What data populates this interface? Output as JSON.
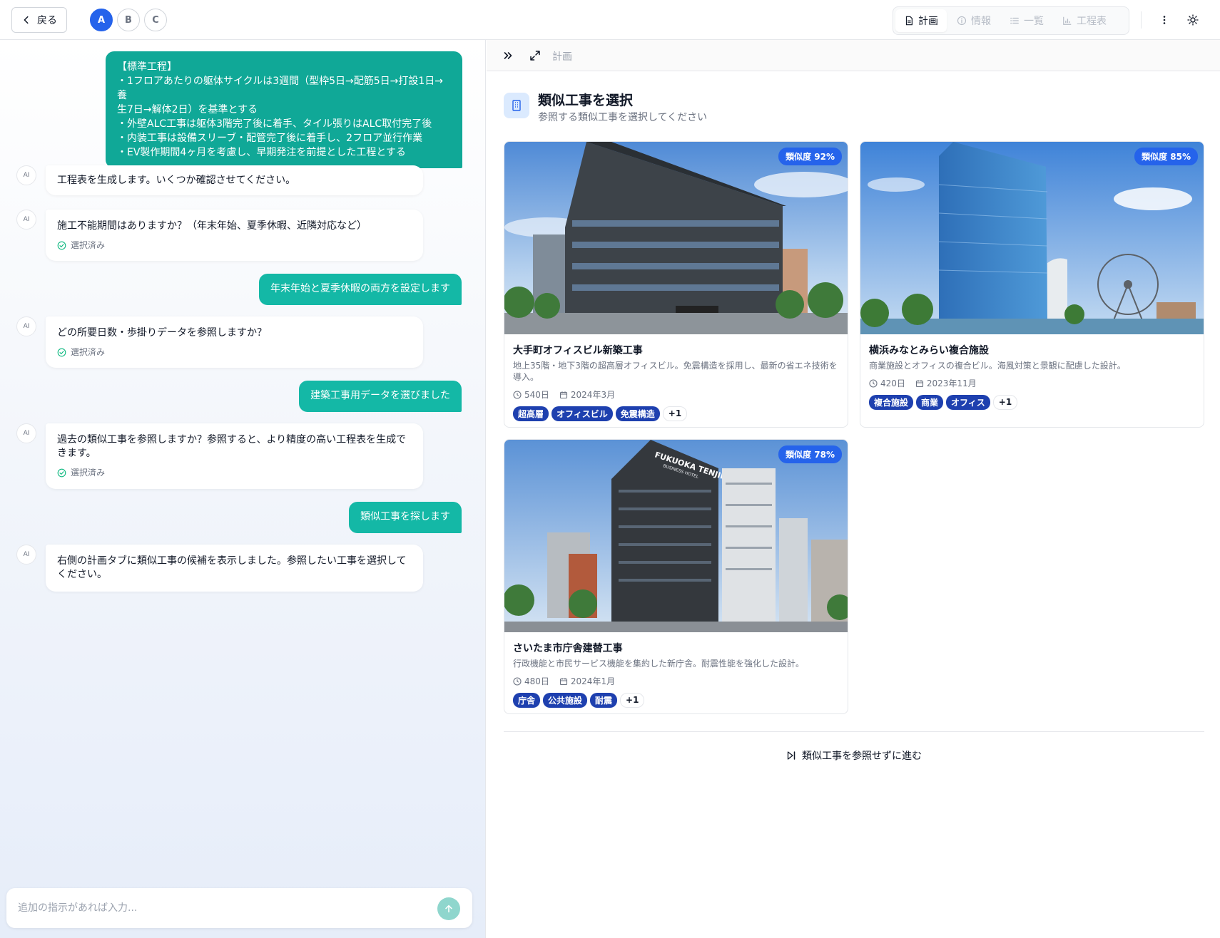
{
  "header": {
    "back_label": "戻る",
    "versions": [
      "A",
      "B",
      "C"
    ],
    "tabs": [
      {
        "label": "計画",
        "icon": "document-icon",
        "active": true
      },
      {
        "label": "情報",
        "icon": "info-icon",
        "active": false
      },
      {
        "label": "一覧",
        "icon": "list-icon",
        "active": false
      },
      {
        "label": "工程表",
        "icon": "bar-chart-icon",
        "active": false
      }
    ]
  },
  "chat": {
    "ai_badge": "AI",
    "selected_label": "選択済み",
    "messages": [
      {
        "role": "user",
        "lines": [
          "【標準工程】",
          "・1フロアあたりの躯体サイクルは3週間（型枠5日→配筋5日→打設1日→養",
          "生7日→解体2日）を基準とする",
          "・外壁ALC工事は躯体3階完了後に着手、タイル張りはALC取付完了後",
          "・内装工事は設備スリーブ・配管完了後に着手し、2フロア並行作業",
          "・EV製作期間4ヶ月を考慮し、早期発注を前提とした工程とする"
        ]
      },
      {
        "role": "ai",
        "text": "工程表を生成します。いくつか確認させてください。"
      },
      {
        "role": "ai",
        "text": "施工不能期間はありますか？（年末年始、夏季休暇、近隣対応など）"
      },
      {
        "role": "user",
        "text": "年末年始と夏季休暇の両方を設定します"
      },
      {
        "role": "ai",
        "text": "どの所要日数・歩掛りデータを参照しますか？"
      },
      {
        "role": "user",
        "text": "建築工事用データを選びました"
      },
      {
        "role": "ai",
        "text": "過去の類似工事を参照しますか？参照すると、より精度の高い工程表を生成できます。"
      },
      {
        "role": "user",
        "text": "類似工事を探します"
      },
      {
        "role": "ai",
        "text": "右側の計画タブに類似工事の候補を表示しました。参照したい工事を選択してください。"
      }
    ],
    "input_placeholder": "追加の指示があれば入力..."
  },
  "panel": {
    "breadcrumb": "計画",
    "section_title": "類似工事を選択",
    "section_subtitle": "参照する類似工事を選択してください",
    "cards": [
      {
        "title": "大手町オフィスビル新築工事",
        "desc_lines": [
          "地上35階・地下3階の超高層オフィスビル。免震構造を採用し、最新の省エネ技術を",
          "導入。"
        ],
        "duration": "540日",
        "date": "2024年3月",
        "similarity": "類似度 92%",
        "tags": [
          "超高層",
          "オフィスビル",
          "免震構造"
        ],
        "more": "+1"
      },
      {
        "title": "横浜みなとみらい複合施設",
        "desc_lines": [
          "商業施設とオフィスの複合ビル。海風対策と景観に配慮した設計。"
        ],
        "duration": "420日",
        "date": "2023年11月",
        "similarity": "類似度 85%",
        "tags": [
          "複合施設",
          "商業",
          "オフィス"
        ],
        "more": "+1"
      },
      {
        "title": "さいたま市庁舎建替工事",
        "desc_lines": [
          "行政機能と市民サービス機能を集約した新庁舎。耐震性能を強化した設計。"
        ],
        "duration": "480日",
        "date": "2024年1月",
        "similarity": "類似度 78%",
        "tags": [
          "庁舎",
          "公共施設",
          "耐震"
        ],
        "more": "+1",
        "sign_text": "FUKUOKA TENJIN",
        "sign_sub": "BUSINESS HOTEL"
      }
    ],
    "skip_label": "類似工事を参照せずに進む"
  },
  "colors": {
    "accent": "#2563eb",
    "user_bubble": "#14b8a6",
    "tag": "#1e40af"
  }
}
